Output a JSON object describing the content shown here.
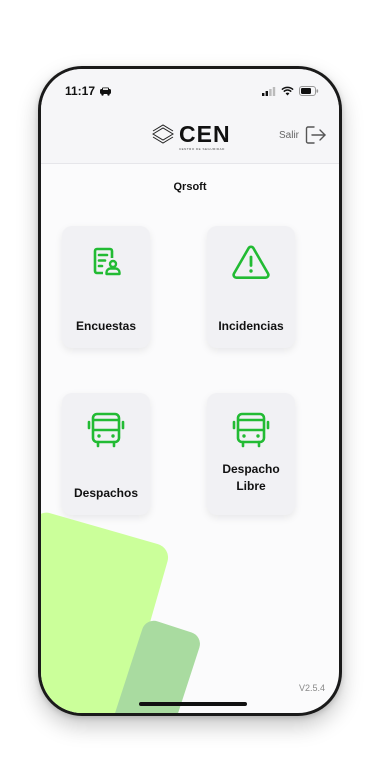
{
  "status_bar": {
    "time": "11:17"
  },
  "header": {
    "logo_text": "CEN",
    "logo_subtitle": "CENTRO DE SEGURIDAD",
    "logout_label": "Salir"
  },
  "company_name": "Qrsoft",
  "tiles": [
    {
      "label": "Encuestas",
      "icon": "survey-icon"
    },
    {
      "label": "Incidencias",
      "icon": "warning-icon"
    },
    {
      "label": "Despachos",
      "icon": "bus-icon"
    },
    {
      "label_line1": "Despacho",
      "label_line2": "Libre",
      "icon": "bus-icon"
    }
  ],
  "version": "V2.5.4",
  "colors": {
    "accent": "#22bb33",
    "blob_light": "#cbff9a",
    "blob_dark": "#a9dba0"
  }
}
